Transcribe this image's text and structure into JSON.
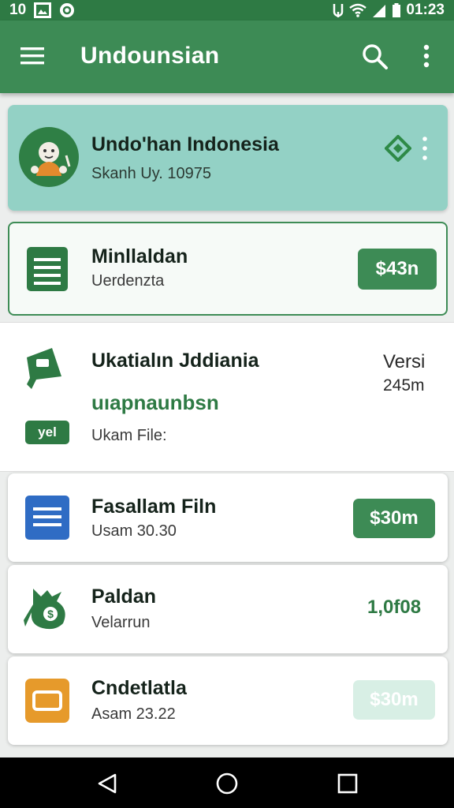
{
  "status_bar": {
    "time_left": "10",
    "time_right": "01:23"
  },
  "app_bar": {
    "title": "Undounsian"
  },
  "featured": {
    "name": "Undo'han Indonesia",
    "sub": "Skanh Uy. 10975"
  },
  "outlined_item": {
    "title": "Minllaldan",
    "sub": "Uerdenzta",
    "pill": "$43n"
  },
  "section_item": {
    "title": "Ukatialın Jddiania",
    "green_text": "uıapnaunbsn",
    "badge": "yel",
    "sub": "Ukam File:",
    "right_top": "Versi",
    "right_bottom": "245m"
  },
  "cards": [
    {
      "title": "Fasallam Filn",
      "sub": "Usam 30.30",
      "right": "$30m",
      "icon": "document-icon",
      "accent": "#2f6cc4"
    },
    {
      "title": "Paldan",
      "sub": "Velarrun",
      "right": "1,0f08",
      "icon": "money-bag-icon",
      "accent": "#2e7a44"
    },
    {
      "title": "Cndetlatla",
      "sub": "Asam 23.22",
      "right": "$30m",
      "icon": "wallet-icon",
      "accent": "#e69a2b"
    }
  ],
  "colors": {
    "primary": "#3d8b55",
    "status": "#2e7a44",
    "featured_bg": "#93d1c5",
    "pill_green": "#3d8b55",
    "pill_faded": "#d8efe5"
  }
}
